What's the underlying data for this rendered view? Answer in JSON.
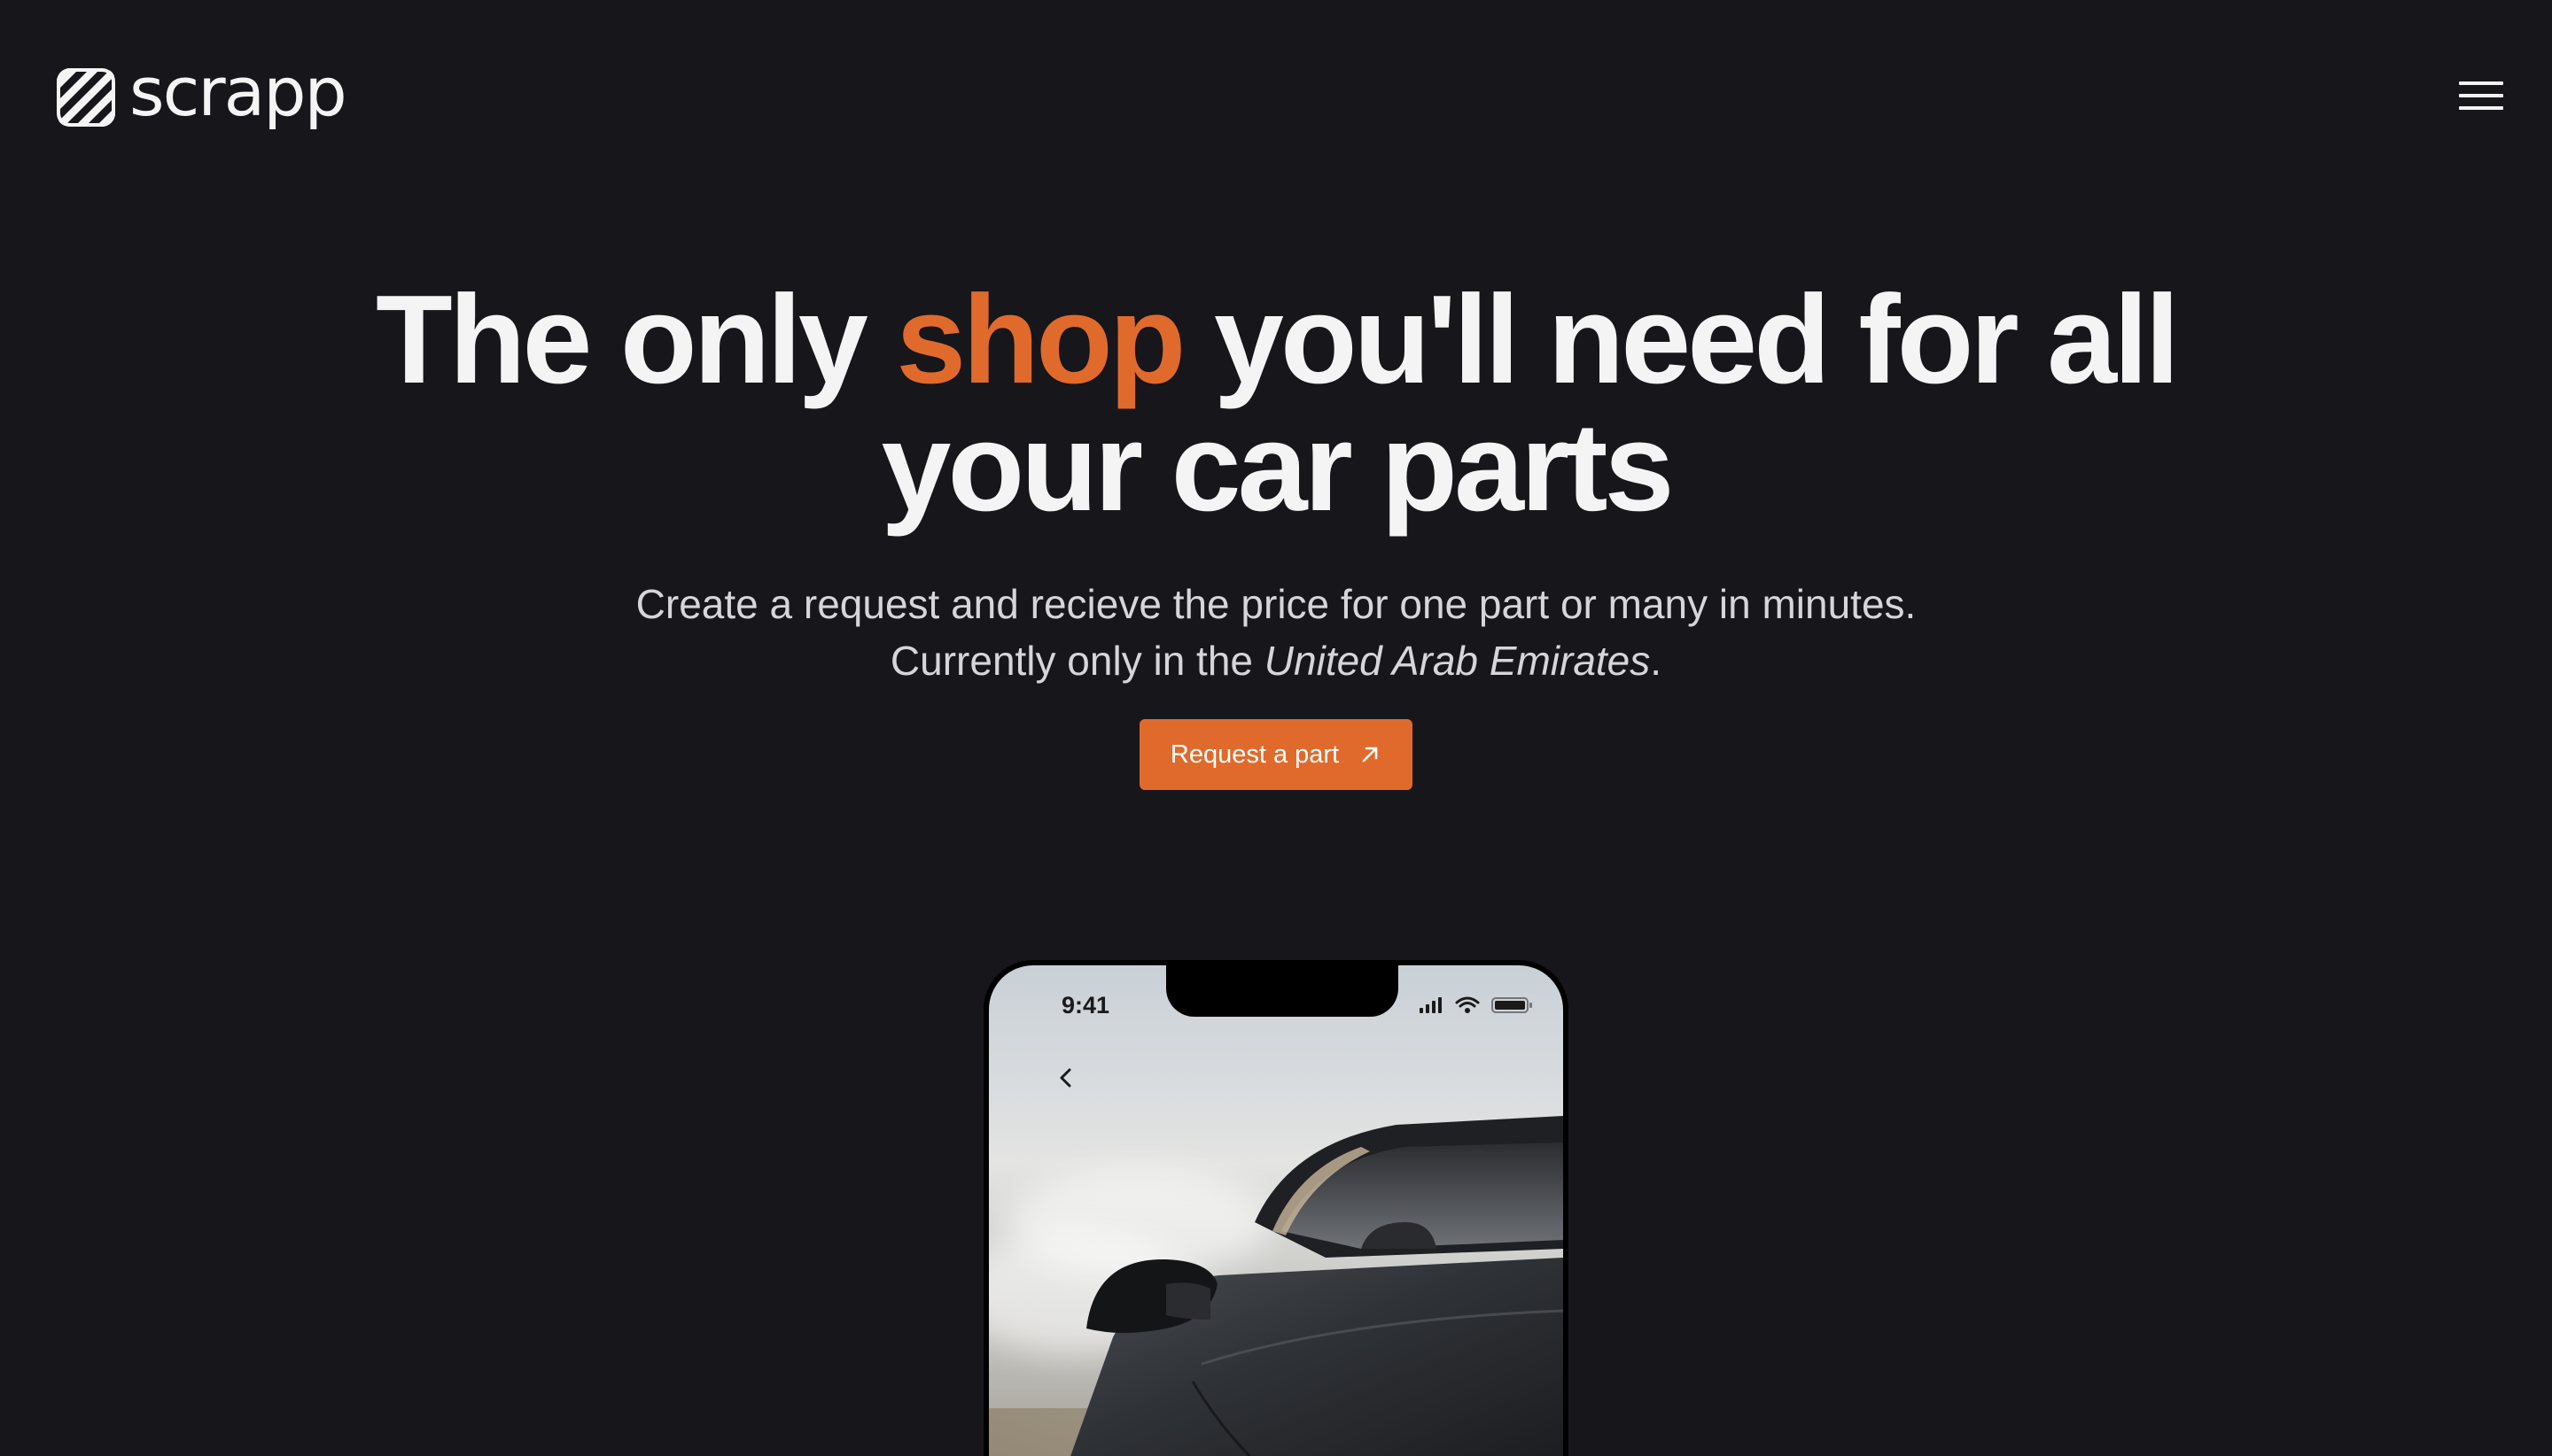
{
  "header": {
    "logo_text": "scrapp",
    "logo_icon": "scrapp-logo-mark",
    "menu_icon": "hamburger-menu-icon"
  },
  "hero": {
    "title_before": "The only ",
    "title_accent": "shop",
    "title_after": " you'll need for all your car parts",
    "subtitle_line1": "Create a request and recieve the price for one part or many in minutes.",
    "subtitle_line2_prefix": "Currently only in the ",
    "subtitle_line2_emphasis": "United Arab Emirates",
    "subtitle_line2_suffix": ".",
    "cta_label": "Request a part",
    "cta_icon": "arrow-up-right-icon"
  },
  "phone": {
    "status_time": "9:41",
    "status_icons": [
      "cellular-signal-icon",
      "wifi-icon",
      "battery-icon"
    ],
    "back_icon": "chevron-left-icon"
  },
  "colors": {
    "background": "#16161b",
    "accent": "#e06a2c",
    "text": "#f4f4f4",
    "subtext": "#d6d6da"
  }
}
